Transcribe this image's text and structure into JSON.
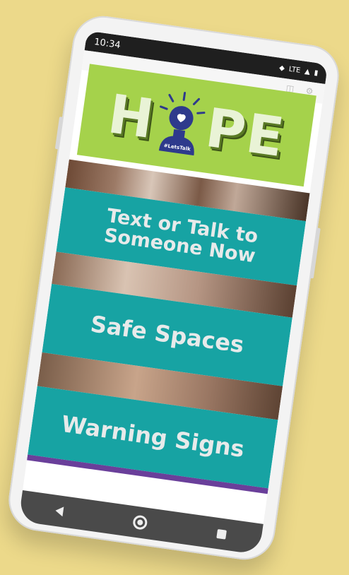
{
  "status_bar": {
    "time": "10:34",
    "network": "LTE"
  },
  "hope_logo": {
    "letters": [
      "H",
      "P",
      "E"
    ],
    "tagline": "#LetsTalk"
  },
  "banners": [
    {
      "label": "Text or Talk to Someone Now"
    },
    {
      "label": "Safe Spaces"
    },
    {
      "label": "Warning Signs"
    }
  ],
  "colors": {
    "background": "#ecd98a",
    "logo_green": "#a5d24b",
    "banner_teal": "#17a3a3",
    "bulb_navy": "#2e3a8c"
  },
  "nav_bar": {
    "icons": [
      "back-icon",
      "home-icon",
      "recent-apps-icon"
    ]
  }
}
